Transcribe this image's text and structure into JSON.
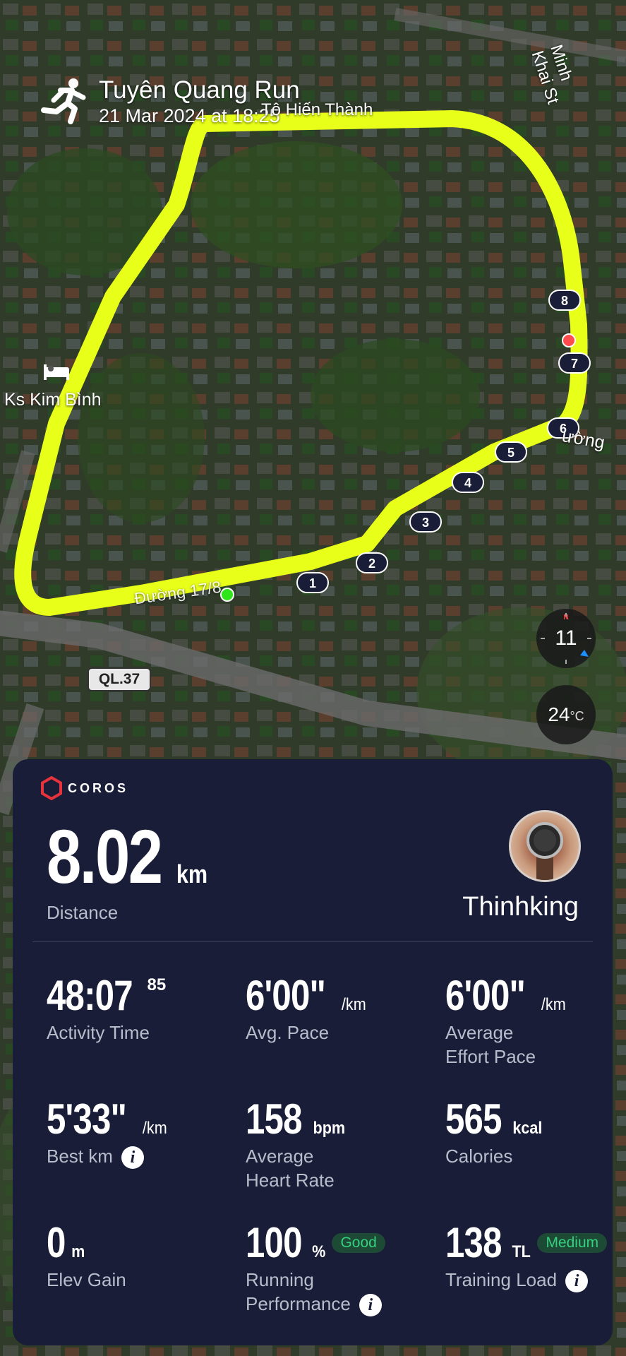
{
  "header": {
    "title": "Tuyên Quang Run",
    "date": "21 Mar 2024 at 18:25",
    "activity_icon": "running-icon"
  },
  "map": {
    "labels": {
      "street_top": "Tô Hiến Thành",
      "street_right": "Minh Khai St",
      "hotel": "Ks Kim Bình",
      "road_partial_right": "ường",
      "road_bottom": "Đường 17/8"
    },
    "road_badge": "QL.37",
    "km_markers": [
      "1",
      "2",
      "3",
      "4",
      "5",
      "6",
      "7",
      "8"
    ],
    "compass_value": "11",
    "temperature": "24",
    "temperature_unit": "°C",
    "route_color": "#e8ff1a"
  },
  "card": {
    "brand": "COROS",
    "distance_value": "8.02",
    "distance_unit": "km",
    "distance_label": "Distance",
    "username": "Thinhking",
    "metrics": {
      "activity_time": {
        "value": "48:07",
        "sup": "85",
        "label": "Activity Time"
      },
      "avg_pace": {
        "value": "6'00\"",
        "unit": "/km",
        "label": "Avg. Pace"
      },
      "effort_pace": {
        "value": "6'00\"",
        "unit": "/km",
        "label_1": "Average",
        "label_2": "Effort Pace"
      },
      "best_km": {
        "value": "5'33\"",
        "unit": "/km",
        "label": "Best km"
      },
      "heart_rate": {
        "value": "158",
        "unit": "bpm",
        "label_1": "Average",
        "label_2": "Heart Rate"
      },
      "calories": {
        "value": "565",
        "unit": "kcal",
        "label": "Calories"
      },
      "elev_gain": {
        "value": "0",
        "unit": "m",
        "label": "Elev Gain"
      },
      "running_perf": {
        "value": "100",
        "unit": "%",
        "badge": "Good",
        "label_1": "Running",
        "label_2": "Performance"
      },
      "training_load": {
        "value": "138",
        "unit": "TL",
        "badge": "Medium",
        "label": "Training Load"
      }
    }
  }
}
